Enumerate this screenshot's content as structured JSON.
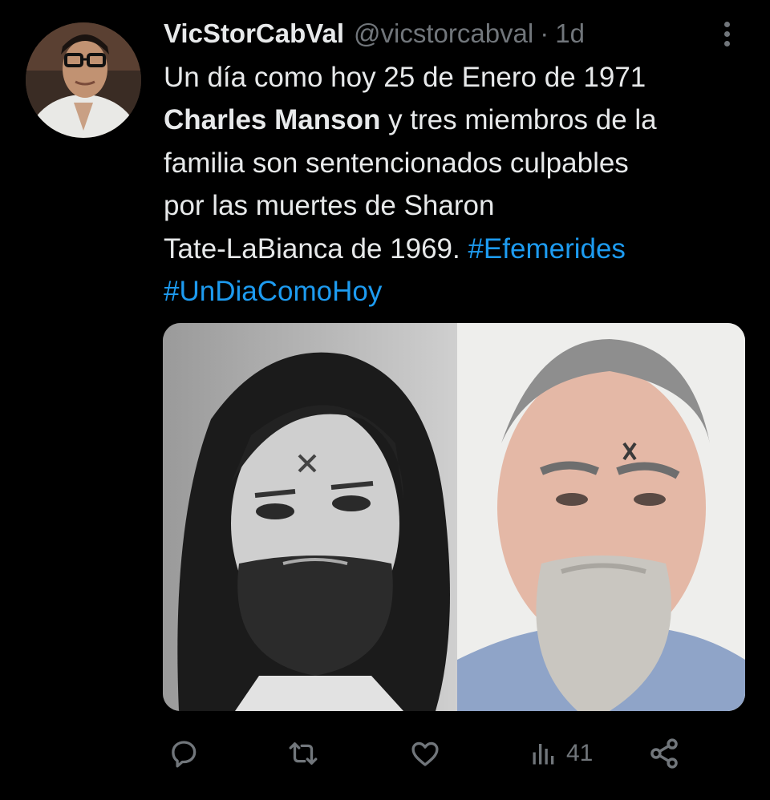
{
  "tweet": {
    "display_name": "VicStorCabVal",
    "handle": "@vicstorcabval",
    "separator": "·",
    "time": "1d",
    "text": {
      "line1": "Un día como hoy 25 de Enero de 1971",
      "line2_bold": "Charles Manson",
      "line2_rest": " y tres miembros de la",
      "line3": "familia son sentencionados culpables",
      "line4": "por las muertes de Sharon",
      "line5_text": "Tate-LaBianca de 1969. ",
      "hashtag1": "#Efemerides",
      "hashtag2": "#UnDiaComoHoy"
    },
    "views_count": "41"
  },
  "icons": {
    "avatar": "avatar",
    "more": "more-vertical-icon",
    "reply": "reply-icon",
    "retweet": "retweet-icon",
    "like": "heart-icon",
    "views": "views-icon",
    "share": "share-icon"
  },
  "colors": {
    "background": "#000000",
    "text": "#e7e9ea",
    "secondary": "#71767b",
    "link": "#1d9bf0"
  }
}
